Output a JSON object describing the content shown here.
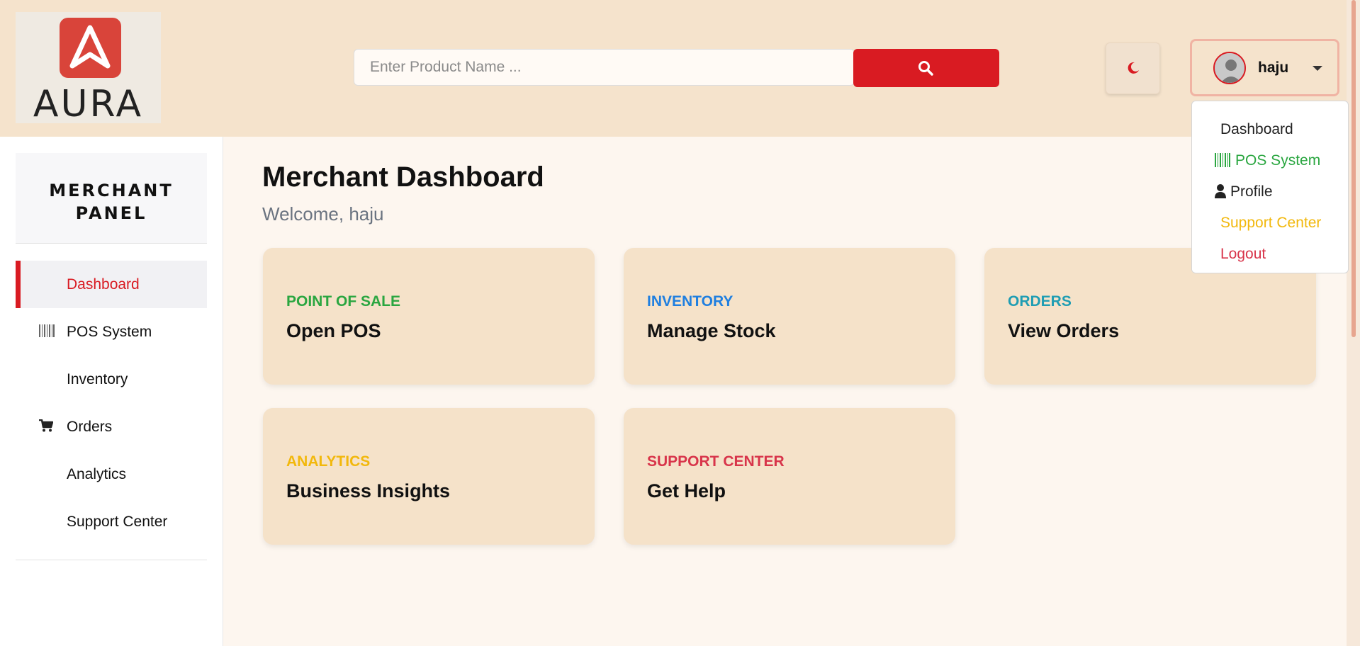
{
  "header": {
    "logo_text": "AURA",
    "search_placeholder": "Enter Product Name ...",
    "search_icon": "search-icon",
    "theme_icon": "moon-icon",
    "username": "haju"
  },
  "user_menu": {
    "items": [
      {
        "label": "Dashboard",
        "color": "#222222"
      },
      {
        "label": "POS System",
        "icon": "barcode-icon",
        "color": "#2aa640"
      },
      {
        "label": "Profile",
        "icon": "user-icon",
        "color": "#222222"
      },
      {
        "label": "Support Center",
        "color": "#f2b80c"
      },
      {
        "label": "Logout",
        "color": "#d8344a"
      }
    ]
  },
  "sidebar": {
    "title": "MERCHANT PANEL",
    "items": [
      {
        "label": "Dashboard",
        "active": true
      },
      {
        "label": "POS System",
        "icon": "barcode-icon"
      },
      {
        "label": "Inventory"
      },
      {
        "label": "Orders",
        "icon": "cart-icon"
      },
      {
        "label": "Analytics"
      },
      {
        "label": "Support Center"
      }
    ]
  },
  "main": {
    "title": "Merchant Dashboard",
    "welcome": "Welcome, haju",
    "cards": [
      {
        "category": "POINT OF SALE",
        "title": "Open POS",
        "color": "#2aa640"
      },
      {
        "category": "INVENTORY",
        "title": "Manage Stock",
        "color": "#1f7fe0"
      },
      {
        "category": "ORDERS",
        "title": "View Orders",
        "color": "#1f9db3"
      },
      {
        "category": "ANALYTICS",
        "title": "Business Insights",
        "color": "#f2b80c"
      },
      {
        "category": "SUPPORT CENTER",
        "title": "Get Help",
        "color": "#d8344a"
      }
    ]
  },
  "colors": {
    "accent": "#d91b22",
    "header_bg": "#f5e3cc",
    "card_bg": "#f5e2c9"
  }
}
